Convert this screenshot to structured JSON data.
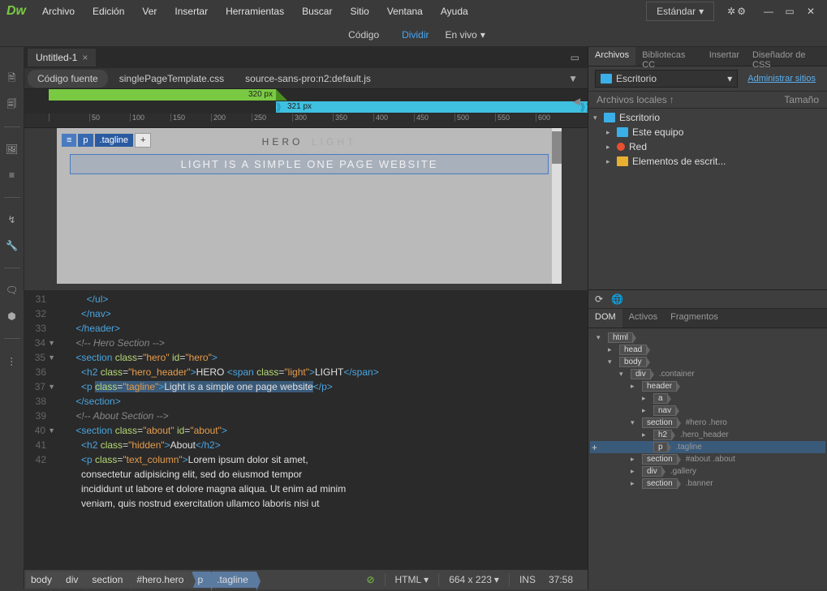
{
  "app": {
    "logo": "Dw"
  },
  "menu": [
    "Archivo",
    "Edición",
    "Ver",
    "Insertar",
    "Herramientas",
    "Buscar",
    "Sitio",
    "Ventana",
    "Ayuda"
  ],
  "workspace": "Estándar",
  "viewSwitcher": {
    "code": "Código",
    "split": "Dividir",
    "live": "En vivo"
  },
  "docTab": {
    "name": "Untitled-1",
    "close": "×"
  },
  "relatedFiles": {
    "source": "Código fuente",
    "css": "singlePageTemplate.css",
    "js": "source-sans-pro:n2:default.js"
  },
  "breakpoints": {
    "green": "320  px",
    "blue": "321  px"
  },
  "rulerMarks": [
    "",
    "50",
    "100",
    "150",
    "200",
    "250",
    "300",
    "350",
    "400",
    "450",
    "500",
    "550",
    "600"
  ],
  "elementChip": {
    "menu": "≡",
    "tag": "p",
    "cls": ".tagline",
    "add": "+"
  },
  "livePreview": {
    "heroA": "HERO",
    "heroB": "LIGHT",
    "tagline": "LIGHT IS A SIMPLE ONE PAGE WEBSITE"
  },
  "code": {
    "startLine": 31,
    "lines": [
      {
        "n": 31,
        "html": "        <span class='tag'>&lt;/ul&gt;</span>"
      },
      {
        "n": 32,
        "html": "      <span class='tag'>&lt;/nav&gt;</span>"
      },
      {
        "n": 33,
        "html": "    <span class='tag'>&lt;/header&gt;</span>"
      },
      {
        "n": 34,
        "html": "    <span class='cmt'>&lt;!-- Hero Section --&gt;</span>",
        "fold": "▼"
      },
      {
        "n": 35,
        "html": "    <span class='tag'>&lt;section</span> <span class='attr'>class</span>=<span class='val'>\"hero\"</span> <span class='attr'>id</span>=<span class='val'>\"hero\"</span><span class='tag'>&gt;</span>",
        "fold": "▼"
      },
      {
        "n": 36,
        "html": "      <span class='tag'>&lt;h2</span> <span class='attr'>class</span>=<span class='val'>\"hero_header\"</span><span class='tag'>&gt;</span><span class='txt'>HERO </span><span class='tag'>&lt;span</span> <span class='attr'>class</span>=<span class='val'>\"light\"</span><span class='tag'>&gt;</span><span class='txt'>LIGHT</span><span class='tag'>&lt;/span&gt;</span>"
      },
      {
        "n": 37,
        "html": "      <span class='tag'>&lt;p</span> <span class='sel-tag'><span class='attr'>class</span>=<span class='val'>\"tagline\"</span><span class='tag'>&gt;</span><span class='txt'>Light is a simple one page website</span></span><span class='tag'>&lt;/p&gt;</span>",
        "fold": "▼"
      },
      {
        "n": 38,
        "html": "    <span class='tag'>&lt;/section&gt;</span>"
      },
      {
        "n": 39,
        "html": "    <span class='cmt'>&lt;!-- About Section --&gt;</span>"
      },
      {
        "n": 40,
        "html": "    <span class='tag'>&lt;section</span> <span class='attr'>class</span>=<span class='val'>\"about\"</span> <span class='attr'>id</span>=<span class='val'>\"about\"</span><span class='tag'>&gt;</span>",
        "fold": "▼"
      },
      {
        "n": 41,
        "html": "      <span class='tag'>&lt;h2</span> <span class='attr'>class</span>=<span class='val'>\"hidden\"</span><span class='tag'>&gt;</span><span class='txt'>About</span><span class='tag'>&lt;/h2&gt;</span>"
      },
      {
        "n": 42,
        "html": "      <span class='tag'>&lt;p</span> <span class='attr'>class</span>=<span class='val'>\"text_column\"</span><span class='tag'>&gt;</span><span class='txt'>Lorem ipsum dolor sit amet,</span>"
      },
      {
        "n": "",
        "html": "      <span class='txt'>consectetur adipisicing elit, sed do eiusmod tempor</span>"
      },
      {
        "n": "",
        "html": "      <span class='txt'>incididunt ut labore et dolore magna aliqua. Ut enim ad minim</span>"
      },
      {
        "n": "",
        "html": "      <span class='txt'>veniam, quis nostrud exercitation ullamco laboris nisi ut</span>"
      }
    ]
  },
  "breadcrumbs": [
    "body",
    "div",
    "section",
    "#hero.hero",
    "p",
    ".tagline"
  ],
  "status": {
    "lang": "HTML",
    "dims": "664 x 223",
    "ins": "INS",
    "time": "37:58"
  },
  "panels": {
    "topTabs": [
      "Archivos",
      "Bibliotecas CC",
      "Insertar",
      "Diseñador de CSS"
    ],
    "folderName": "Escritorio",
    "adminLink": "Administrar sitios",
    "cols": {
      "name": "Archivos locales",
      "size": "Tamaño"
    },
    "files": [
      {
        "depth": 0,
        "arrow": "▾",
        "icon": "monitor",
        "label": "Escritorio"
      },
      {
        "depth": 1,
        "arrow": "▸",
        "icon": "pc",
        "label": "Este equipo"
      },
      {
        "depth": 1,
        "arrow": "▸",
        "icon": "net",
        "label": "Red"
      },
      {
        "depth": 1,
        "arrow": "▸",
        "icon": "folder",
        "label": "Elementos de escrit..."
      }
    ],
    "bottomTabs": [
      "DOM",
      "Activos",
      "Fragmentos"
    ],
    "dom": [
      {
        "d": 0,
        "arrow": "▾",
        "tag": "html"
      },
      {
        "d": 1,
        "arrow": "▸",
        "tag": "head"
      },
      {
        "d": 1,
        "arrow": "▾",
        "tag": "body"
      },
      {
        "d": 2,
        "arrow": "▾",
        "tag": "div",
        "extra": ".container"
      },
      {
        "d": 3,
        "arrow": "▸",
        "tag": "header"
      },
      {
        "d": 4,
        "arrow": "▸",
        "tag": "a"
      },
      {
        "d": 4,
        "arrow": "▸",
        "tag": "nav"
      },
      {
        "d": 3,
        "arrow": "▾",
        "tag": "section",
        "extra": "#hero .hero"
      },
      {
        "d": 4,
        "arrow": "▸",
        "tag": "h2",
        "extra": ".hero_header"
      },
      {
        "d": 4,
        "arrow": "",
        "tag": "p",
        "extra": ".tagline",
        "selected": true
      },
      {
        "d": 3,
        "arrow": "▸",
        "tag": "section",
        "extra": "#about .about"
      },
      {
        "d": 3,
        "arrow": "▸",
        "tag": "div",
        "extra": ".gallery"
      },
      {
        "d": 3,
        "arrow": "▸",
        "tag": "section",
        "extra": ".banner"
      }
    ]
  }
}
